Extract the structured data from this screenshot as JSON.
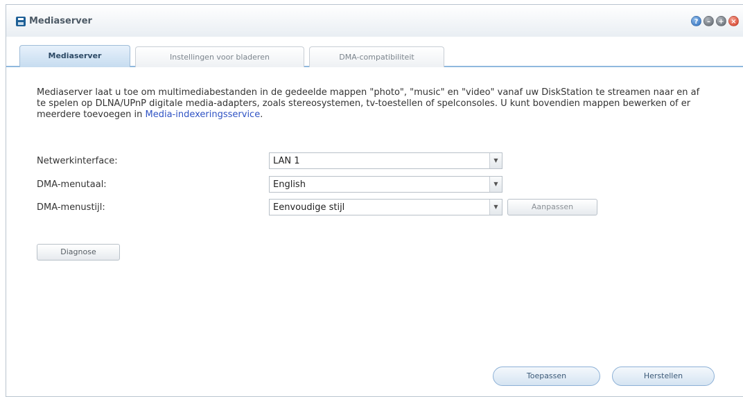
{
  "window": {
    "title": "Mediaserver",
    "controls": [
      "?",
      "–",
      "+",
      "×"
    ]
  },
  "tabs": [
    {
      "label": "Mediaserver",
      "active": true
    },
    {
      "label": "Instellingen voor bladeren",
      "active": false
    },
    {
      "label": "DMA-compatibiliteit",
      "active": false
    }
  ],
  "description": {
    "text": "Mediaserver laat u toe om multimediabestanden in de gedeelde mappen \"photo\", \"music\" en \"video\" vanaf uw DiskStation te streamen naar en af te spelen op DLNA/UPnP digitale media-adapters, zoals stereosystemen, tv-toestellen of spelconsoles. U kunt bovendien mappen bewerken of er meerdere toevoegen in ",
    "link": "Media-indexeringsservice",
    "suffix": "."
  },
  "form": {
    "network_label": "Netwerkinterface:",
    "network_value": "LAN 1",
    "language_label": "DMA-menutaal:",
    "language_value": "English",
    "style_label": "DMA-menustijl:",
    "style_value": "Eenvoudige stijl",
    "customize_button": "Aanpassen",
    "dropdown_arrow": "▼"
  },
  "buttons": {
    "diagnose": "Diagnose",
    "apply": "Toepassen",
    "reset": "Herstellen"
  },
  "colors": {
    "accent": "#2f6fbf",
    "link": "#2f53c4",
    "tab_underline": "#8fb8de"
  }
}
